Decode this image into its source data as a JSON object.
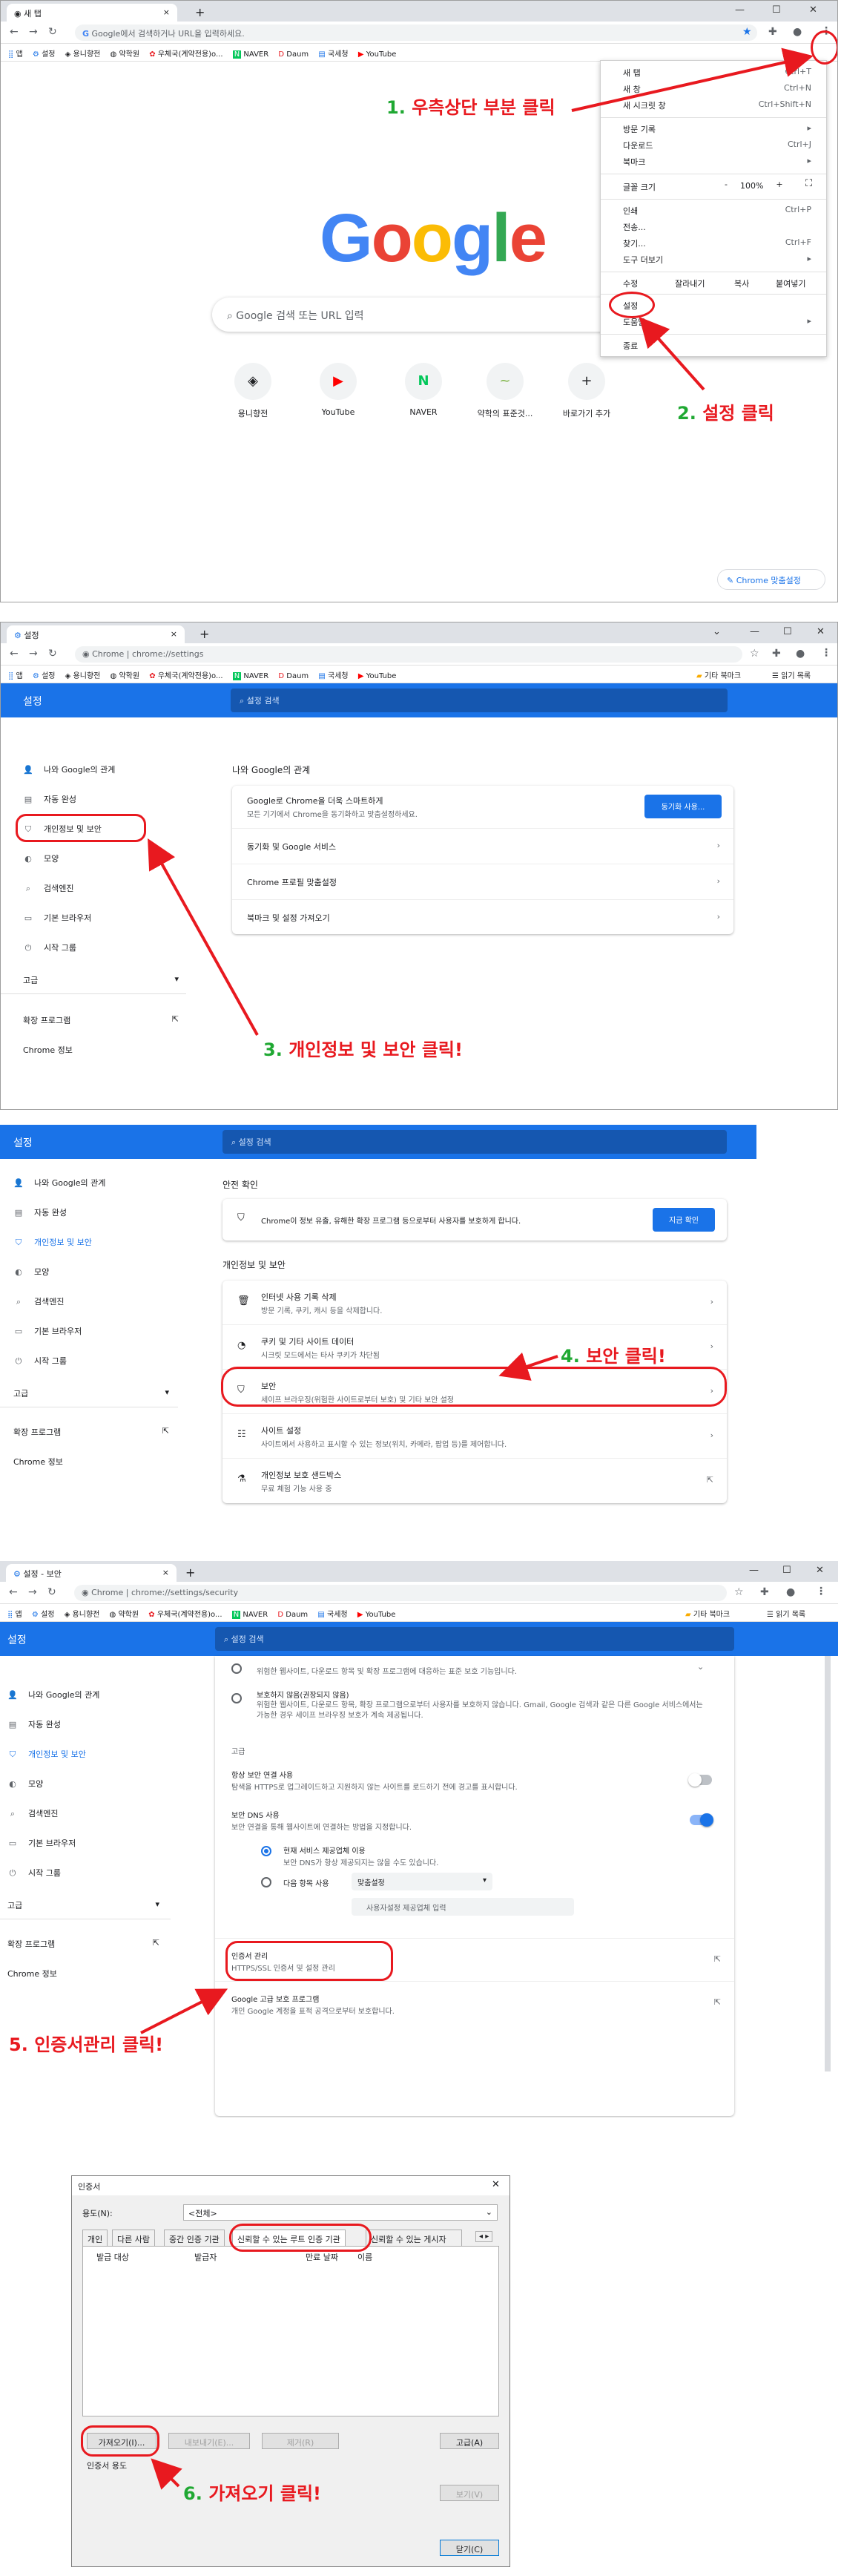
{
  "panel1": {
    "tab_title": "새 탭",
    "omnibox_placeholder": "Google에서 검색하거나 URL을 입력하세요.",
    "bookmarks": [
      "앱",
      "설정",
      "용니향전",
      "약학원",
      "우체국(계약전용)o...",
      "NAVER",
      "Daum",
      "국세청",
      "YouTube"
    ],
    "google_logo": "Google",
    "search_placeholder": "Google 검색 또는 URL 입력",
    "shortcuts": [
      {
        "label": "용니향전",
        "icon": "yongni-icon"
      },
      {
        "label": "YouTube",
        "icon": "youtube-icon"
      },
      {
        "label": "NAVER",
        "icon": "naver-icon"
      },
      {
        "label": "약학의 표준것...",
        "icon": "leaf-icon"
      },
      {
        "label": "바로가기 추가",
        "icon": "plus-icon"
      }
    ],
    "customize_label": "Chrome 맞춤설정",
    "menu": {
      "items": [
        {
          "label": "새 탭",
          "key": "Ctrl+T"
        },
        {
          "label": "새 창",
          "key": "Ctrl+N"
        },
        {
          "label": "새 시크릿 창",
          "key": "Ctrl+Shift+N"
        },
        {
          "label": "방문 기록",
          "key": "▸"
        },
        {
          "label": "다운로드",
          "key": "Ctrl+J"
        },
        {
          "label": "북마크",
          "key": "▸"
        },
        {
          "label": "인쇄",
          "key": "Ctrl+P"
        },
        {
          "label": "전송...",
          "key": ""
        },
        {
          "label": "찾기...",
          "key": "Ctrl+F"
        },
        {
          "label": "도구 더보기",
          "key": "▸"
        }
      ],
      "zoom_label": "글꼴 크기",
      "zoom_minus": "-",
      "zoom_value": "100%",
      "zoom_plus": "+",
      "edit_label": "수정",
      "cut": "잘라내기",
      "copy": "복사",
      "paste": "붙여넣기",
      "settings": "설정",
      "help": "도움말",
      "exit": "종료"
    },
    "annotation1_num": "1.",
    "annotation1_text": "우측상단 부분 클릭",
    "annotation2_num": "2.",
    "annotation2_text": "설정 클릭"
  },
  "panel2": {
    "tab_title": "설정",
    "chrome_label": "Chrome",
    "url": "chrome://settings",
    "bookmarks": [
      "앱",
      "설정",
      "용니향전",
      "약학원",
      "우체국(계약전용)o...",
      "NAVER",
      "Daum",
      "국세청",
      "YouTube"
    ],
    "other_bookmarks": "기타 북마크",
    "reading_list": "읽기 목록",
    "header_title": "설정",
    "search_placeholder": "설정 검색",
    "sidebar": [
      "나와 Google의 관계",
      "자동 완성",
      "개인정보 및 보안",
      "모양",
      "검색엔진",
      "기본 브라우저",
      "시작 그룹"
    ],
    "advanced": "고급",
    "extensions": "확장 프로그램",
    "about": "Chrome 정보",
    "section_title": "나와 Google의 관계",
    "sync_title": "Google로 Chrome을 더욱 스마트하게",
    "sync_sub": "모든 기기에서 Chrome을 동기화하고 맞춤설정하세요.",
    "sync_button": "동기화 사용...",
    "rows": [
      "동기화 및 Google 서비스",
      "Chrome 프로필 맞춤설정",
      "북마크 및 설정 가져오기"
    ],
    "annotation_num": "3.",
    "annotation_text": "개인정보 및 보안  클릭!"
  },
  "panel3": {
    "header_title": "설정",
    "search_placeholder": "설정 검색",
    "sidebar": [
      "나와 Google의 관계",
      "자동 완성",
      "개인정보 및 보안",
      "모양",
      "검색엔진",
      "기본 브라우저",
      "시작 그룹"
    ],
    "advanced": "고급",
    "extensions": "확장 프로그램",
    "about": "Chrome 정보",
    "safety_title": "안전 확인",
    "safety_text": "Chrome이 정보 유출, 유해한 확장 프로그램 등으로부터 사용자를 보호하게 합니다.",
    "safety_button": "지금 확인",
    "privacy_title": "개인정보 및 보안",
    "rows": [
      {
        "title": "인터넷 사용 기록 삭제",
        "sub": "방문 기록, 쿠키, 캐시 등을 삭제합니다."
      },
      {
        "title": "쿠키 및 기타 사이트 데이터",
        "sub": "시크릿 모드에서는 타사 쿠키가 차단됨"
      },
      {
        "title": "보안",
        "sub": "세이프 브라우징(위험한 사이트로부터 보호) 및 기타 보안 설정"
      },
      {
        "title": "사이트 설정",
        "sub": "사이트에서 사용하고 표시할 수 있는 정보(위치, 카메라, 팝업 등)를 제어합니다."
      },
      {
        "title": "개인정보 보호 샌드박스",
        "sub": "무료 체험 기능 사용 중"
      }
    ],
    "annotation_num": "4.",
    "annotation_text": "보안  클릭!"
  },
  "panel4": {
    "tab_title": "설정 - 보안",
    "chrome_label": "Chrome",
    "url": "chrome://settings/security",
    "bookmarks": [
      "앱",
      "설정",
      "용니향전",
      "약학원",
      "우체국(계약전용)o...",
      "NAVER",
      "Daum",
      "국세청",
      "YouTube"
    ],
    "other_bookmarks": "기타 북마크",
    "reading_list": "읽기 목록",
    "header_title": "설정",
    "search_placeholder": "설정 검색",
    "sidebar": [
      "나와 Google의 관계",
      "자동 완성",
      "개인정보 및 보안",
      "모양",
      "검색엔진",
      "기본 브라우저",
      "시작 그룹"
    ],
    "advanced": "고급",
    "extensions": "확장 프로그램",
    "about": "Chrome 정보",
    "std_sub": "위험한 웹사이트, 다운로드 항목 및 확장 프로그램에 대응하는 표준 보호 기능입니다.",
    "enh_title": "보호하지 않음(권장되지 않음)",
    "enh_sub": "위험한 웹사이트, 다운로드 항목, 확장 프로그램으로부터 사용자를 보호하지 않습니다. Gmail, Google 검색과 같은 다른 Google 서비스에서는 가능한 경우 세이프 브라우징 보호가 계속 제공됩니다.",
    "adv_label": "고급",
    "https_title": "항상 보안 연결 사용",
    "https_sub": "탐색을 HTTPS로 업그레이드하고 지원하지 않는 사이트를 로드하기 전에 경고를 표시합니다.",
    "dns_title": "보안 DNS 사용",
    "dns_sub": "보안 연결을 통해 웹사이트에 연결하는 방법을 지정합니다.",
    "dns_opt1": "현재 서비스 제공업체 이용",
    "dns_opt1_sub": "보안 DNS가 항상 제공되지는 않을 수도 있습니다.",
    "dns_opt2": "다음 항목 사용",
    "dns_select": "맞춤설정",
    "dns_input_placeholder": "사용자설정 제공업체 입력",
    "cert_title": "인증서 관리",
    "cert_sub": "HTTPS/SSL 인증서 및 설정 관리",
    "adv_prog_title": "Google 고급 보호 프로그램",
    "adv_prog_sub": "개인 Google 계정을 표적 공격으로부터 보호합니다.",
    "annotation_num": "5.",
    "annotation_text": "인증서관리 클릭!"
  },
  "panel5": {
    "title": "인증서",
    "purpose_label": "용도(N):",
    "purpose_value": "<전체>",
    "tabs": [
      "개인",
      "다른 사람",
      "중간 인증 기관",
      "신뢰할 수 있는 루트 인증 기관",
      "신뢰할 수 있는 게시자"
    ],
    "tab_arrows": "◂ ▸",
    "columns": [
      "발급 대상",
      "발급자",
      "만료 날짜",
      "이름"
    ],
    "import_button": "가져오기(I)...",
    "export_button": "내보내기(E)...",
    "remove_button": "제거(R)",
    "advanced_button": "고급(A)",
    "purposes_label": "인증서 용도",
    "view_button": "보기(V)",
    "close_button": "닫기(C)",
    "annotation_num": "6.",
    "annotation_text": "가져오기 클릭!"
  },
  "colors": {
    "accent": "#1a73e8",
    "annotation_red": "#e8191f",
    "annotation_green": "#1fa832"
  }
}
